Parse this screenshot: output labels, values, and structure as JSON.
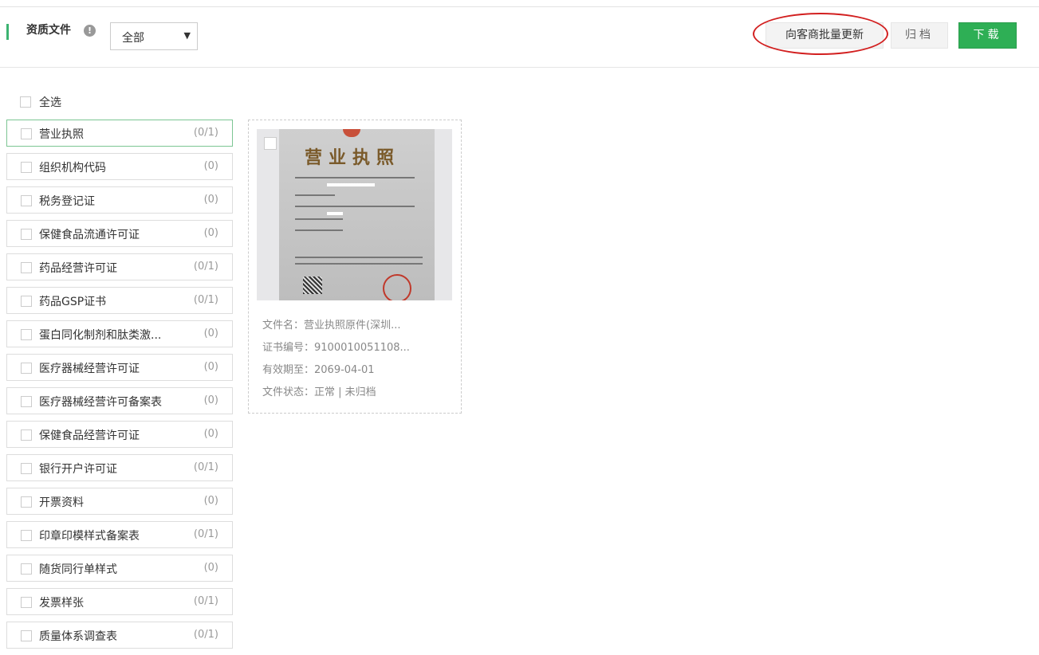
{
  "header": {
    "title": "资质文件",
    "info_icon": "info-icon",
    "filter_value": "全部",
    "update_button": "向客商批量更新",
    "archive_button": "归档",
    "download_button": "下载"
  },
  "colors": {
    "accent": "#3cb371",
    "download_bg": "#2eaf55",
    "highlight_ellipse": "#d21f1f"
  },
  "select_all": "全选",
  "categories": [
    {
      "label": "营业执照",
      "count": "(0/1)"
    },
    {
      "label": "组织机构代码",
      "count": "(0)"
    },
    {
      "label": "税务登记证",
      "count": "(0)"
    },
    {
      "label": "保健食品流通许可证",
      "count": "(0)"
    },
    {
      "label": "药品经营许可证",
      "count": "(0/1)"
    },
    {
      "label": "药品GSP证书",
      "count": "(0/1)"
    },
    {
      "label": "蛋白同化制剂和肽类激...",
      "count": "(0)"
    },
    {
      "label": "医疗器械经营许可证",
      "count": "(0)"
    },
    {
      "label": "医疗器械经营许可备案表",
      "count": "(0)"
    },
    {
      "label": "保健食品经营许可证",
      "count": "(0)"
    },
    {
      "label": "银行开户许可证",
      "count": "(0/1)"
    },
    {
      "label": "开票资料",
      "count": "(0)"
    },
    {
      "label": "印章印模样式备案表",
      "count": "(0/1)"
    },
    {
      "label": "随货同行单样式",
      "count": "(0)"
    },
    {
      "label": "发票样张",
      "count": "(0/1)"
    },
    {
      "label": "质量体系调查表",
      "count": "(0/1)"
    }
  ],
  "file_card": {
    "thumb_heading": "营业执照",
    "file_name": "文件名：营业执照原件(深圳...",
    "cert_no": "证书编号：9100010051108...",
    "valid_until": "有效期至：2069-04-01",
    "status": "文件状态：正常 | 未归档"
  }
}
